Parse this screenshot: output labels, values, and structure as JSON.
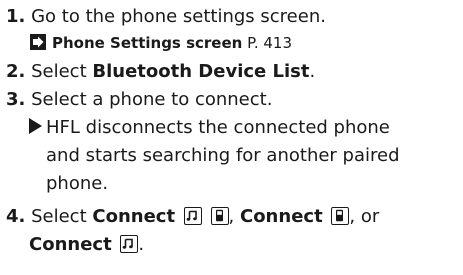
{
  "steps": [
    {
      "number": "1.",
      "text": "Go to the phone settings screen."
    },
    {
      "number": "2.",
      "text_pre": "Select ",
      "bold": "Bluetooth Device List",
      "text_post": "."
    },
    {
      "number": "3.",
      "text": "Select a phone to connect."
    },
    {
      "number": "4.",
      "text_pre": "Select ",
      "bold1": "Connect",
      "sep1": ", ",
      "bold2": "Connect",
      "sep2": ", or",
      "bold3": "Connect",
      "end": "."
    }
  ],
  "reference": {
    "title": "Phone Settings screen",
    "page": "P. 413",
    "icon": "arrow-right-box-icon"
  },
  "result": {
    "line1": "HFL disconnects the connected phone",
    "line2": "and starts searching for another paired",
    "line3": "phone."
  },
  "icons": {
    "music": "music-note-icon",
    "phone": "phone-icon"
  }
}
